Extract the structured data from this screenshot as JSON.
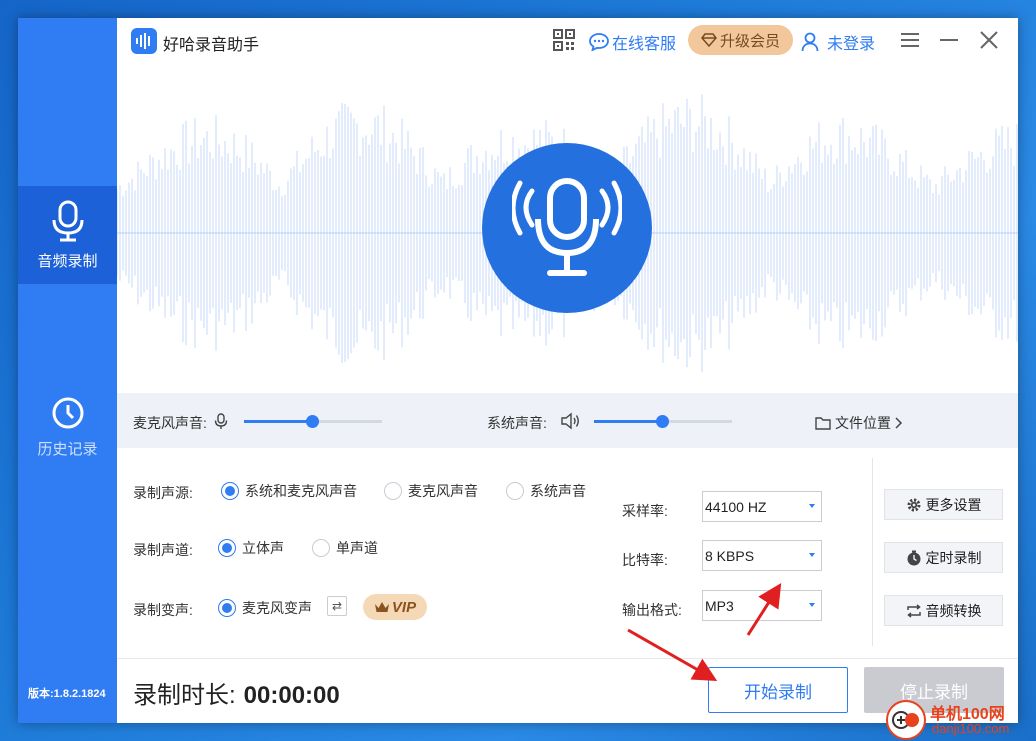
{
  "app": {
    "title": "好哈录音助手",
    "version": "版本:1.8.2.1824"
  },
  "titlebar": {
    "service_label": "在线客服",
    "upgrade_label": "升级会员",
    "login_label": "未登录"
  },
  "sidebar": {
    "items": [
      {
        "label": "音频录制",
        "icon": "microphone-icon",
        "active": true
      },
      {
        "label": "历史记录",
        "icon": "clock-icon",
        "active": false
      }
    ]
  },
  "volume": {
    "mic_label": "麦克风声音:",
    "mic_level": 0.5,
    "system_label": "系统声音:",
    "system_level": 0.5,
    "file_location": "文件位置"
  },
  "settings": {
    "source": {
      "label": "录制声源:",
      "options": [
        "系统和麦克风声音",
        "麦克风声音",
        "系统声音"
      ],
      "selected": 0
    },
    "channel": {
      "label": "录制声道:",
      "options": [
        "立体声",
        "单声道"
      ],
      "selected": 0
    },
    "voice_change": {
      "label": "录制变声:",
      "option": "麦克风变声",
      "vip_tag": "VIP"
    },
    "sample_rate": {
      "label": "采样率:",
      "value": "44100 HZ"
    },
    "bit_rate": {
      "label": "比特率:",
      "value": "8 KBPS"
    },
    "output_format": {
      "label": "输出格式:",
      "value": "MP3"
    },
    "buttons": {
      "more": "更多设置",
      "timer": "定时录制",
      "convert": "音频转换"
    }
  },
  "footer": {
    "duration_label": "录制时长:",
    "duration_value": "00:00:00",
    "start_label": "开始录制",
    "stop_label": "停止录制"
  },
  "watermark": {
    "line1": "单机100网",
    "line2": "danji100.com"
  },
  "colors": {
    "accent": "#2f7cf3",
    "sidebar": "#2f7cf3",
    "annotation_arrow": "#e02020"
  }
}
